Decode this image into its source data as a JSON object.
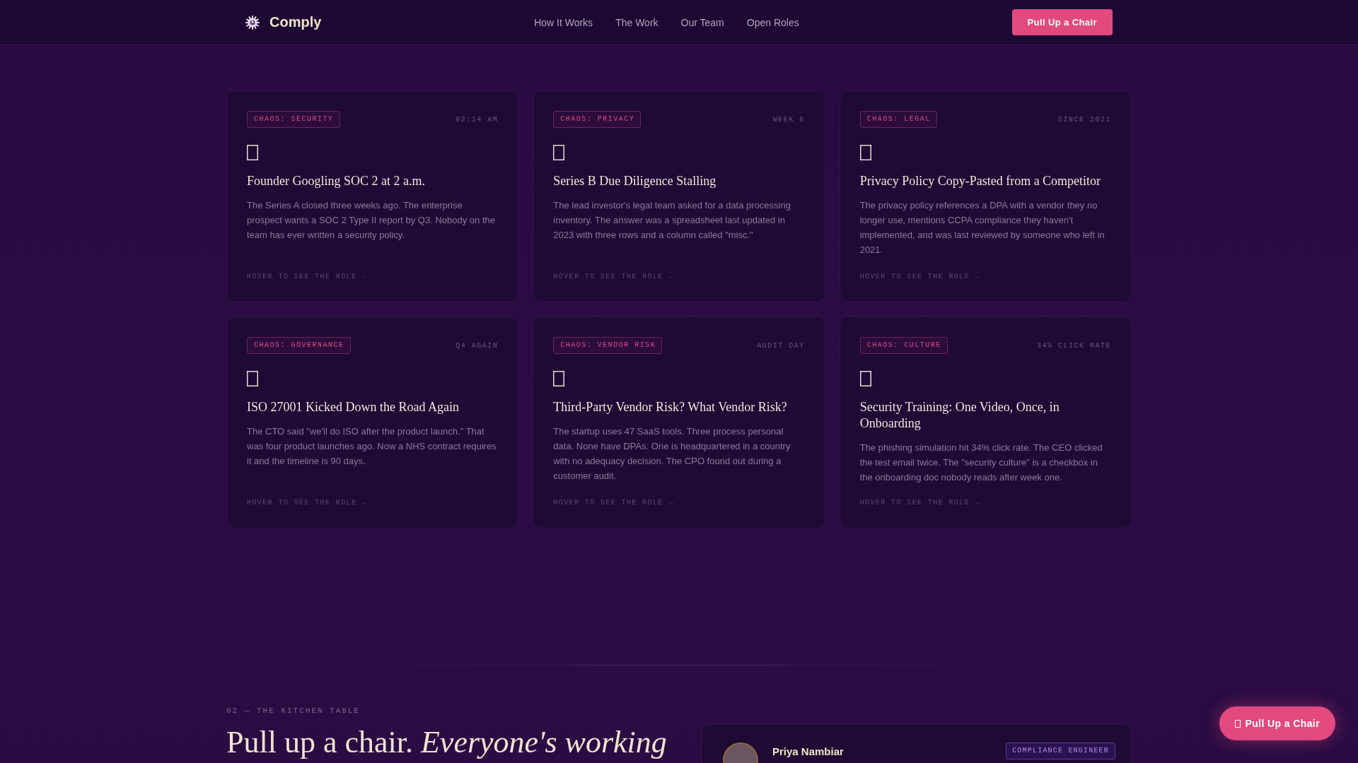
{
  "nav": {
    "brand": "Comply",
    "links": [
      "How It Works",
      "The Work",
      "Our Team",
      "Open Roles"
    ],
    "cta": "Pull Up a Chair"
  },
  "cards": [
    {
      "tag": "CHAOS: SECURITY",
      "meta": "02:14 AM",
      "title": "Founder Googling SOC 2 at 2 a.m.",
      "body": "The Series A closed three weeks ago. The enterprise prospect wants a SOC 2 Type II report by Q3. Nobody on the team has ever written a security policy.",
      "hint": "HOVER TO SEE THE ROLE →"
    },
    {
      "tag": "CHAOS: PRIVACY",
      "meta": "WEEK 6",
      "title": "Series B Due Diligence Stalling",
      "body": "The lead investor's legal team asked for a data processing inventory. The answer was a spreadsheet last updated in 2023 with three rows and a column called \"misc.\"",
      "hint": "HOVER TO SEE THE ROLE →"
    },
    {
      "tag": "CHAOS: LEGAL",
      "meta": "SINCE 2021",
      "title": "Privacy Policy Copy-Pasted from a Competitor",
      "body": "The privacy policy references a DPA with a vendor they no longer use, mentions CCPA compliance they haven't implemented, and was last reviewed by someone who left in 2021.",
      "hint": "HOVER TO SEE THE ROLE →"
    },
    {
      "tag": "CHAOS: GOVERNANCE",
      "meta": "Q4 AGAIN",
      "title": "ISO 27001 Kicked Down the Road Again",
      "body": "The CTO said \"we'll do ISO after the product launch.\" That was four product launches ago. Now a NHS contract requires it and the timeline is 90 days.",
      "hint": "HOVER TO SEE THE ROLE →"
    },
    {
      "tag": "CHAOS: VENDOR RISK",
      "meta": "AUDIT DAY",
      "title": "Third-Party Vendor Risk? What Vendor Risk?",
      "body": "The startup uses 47 SaaS tools. Three process personal data. None have DPAs. One is headquartered in a country with no adequacy decision. The CPO found out during a customer audit.",
      "hint": "HOVER TO SEE THE ROLE →"
    },
    {
      "tag": "CHAOS: CULTURE",
      "meta": "34% CLICK RATE",
      "title": "Security Training: One Video, Once, in Onboarding",
      "body": "The phishing simulation hit 34% click rate. The CEO clicked the test email twice. The \"security culture\" is a checkbox in the onboarding doc nobody reads after week one.",
      "hint": "HOVER TO SEE THE ROLE →"
    }
  ],
  "kitchen": {
    "eyebrow": "02 — THE KITCHEN TABLE",
    "heading": "Pull up a chair. *Everyone's working*",
    "profile": {
      "name": "Priya Nambiar",
      "role": "COMPLIANCE ENGINEER"
    }
  },
  "floating_button": {
    "label": "Pull Up a Chair"
  }
}
